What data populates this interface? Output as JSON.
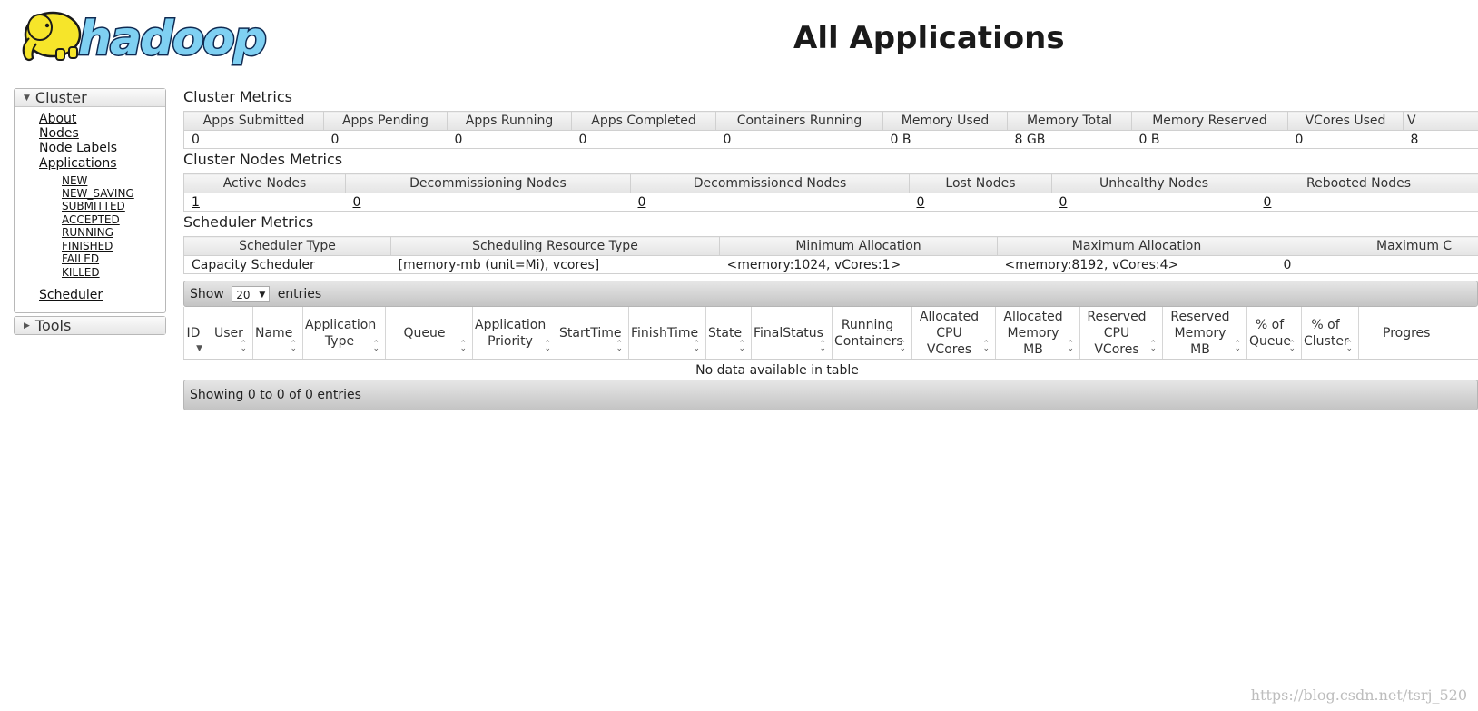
{
  "logo": {
    "wordmark": "hadoop"
  },
  "page_title": "All Applications",
  "sidebar": {
    "cluster": {
      "label": "Cluster",
      "links": [
        "About",
        "Nodes",
        "Node Labels",
        "Applications"
      ],
      "app_states": [
        "NEW",
        "NEW_SAVING",
        "SUBMITTED",
        "ACCEPTED",
        "RUNNING",
        "FINISHED",
        "FAILED",
        "KILLED"
      ],
      "scheduler": "Scheduler"
    },
    "tools": {
      "label": "Tools"
    }
  },
  "cluster_metrics": {
    "title": "Cluster Metrics",
    "headers": [
      "Apps Submitted",
      "Apps Pending",
      "Apps Running",
      "Apps Completed",
      "Containers Running",
      "Memory Used",
      "Memory Total",
      "Memory Reserved",
      "VCores Used",
      "V"
    ],
    "values": [
      "0",
      "0",
      "0",
      "0",
      "0",
      "0 B",
      "8 GB",
      "0 B",
      "0",
      "8"
    ]
  },
  "node_metrics": {
    "title": "Cluster Nodes Metrics",
    "headers": [
      "Active Nodes",
      "Decommissioning Nodes",
      "Decommissioned Nodes",
      "Lost Nodes",
      "Unhealthy Nodes",
      "Rebooted Nodes"
    ],
    "values": [
      "1",
      "0",
      "0",
      "0",
      "0",
      "0"
    ]
  },
  "scheduler_metrics": {
    "title": "Scheduler Metrics",
    "headers": [
      "Scheduler Type",
      "Scheduling Resource Type",
      "Minimum Allocation",
      "Maximum Allocation",
      "Maximum C"
    ],
    "values": [
      "Capacity Scheduler",
      "[memory-mb (unit=Mi), vcores]",
      "<memory:1024, vCores:1>",
      "<memory:8192, vCores:4>",
      "0"
    ]
  },
  "apps": {
    "show_label": "Show",
    "page_size": "20",
    "entries_label": "entries",
    "columns": [
      [
        "ID"
      ],
      [
        "User"
      ],
      [
        "Name"
      ],
      [
        "Application",
        "Type"
      ],
      [
        "Queue"
      ],
      [
        "Application",
        "Priority"
      ],
      [
        "StartTime"
      ],
      [
        "FinishTime"
      ],
      [
        "State"
      ],
      [
        "FinalStatus"
      ],
      [
        "Running",
        "Containers"
      ],
      [
        "Allocated",
        "CPU",
        "VCores"
      ],
      [
        "Allocated",
        "Memory",
        "MB"
      ],
      [
        "Reserved",
        "CPU",
        "VCores"
      ],
      [
        "Reserved",
        "Memory",
        "MB"
      ],
      [
        "% of",
        "Queue"
      ],
      [
        "% of",
        "Cluster"
      ],
      [
        "Progres"
      ]
    ],
    "empty_text": "No data available in table",
    "footer_text": "Showing 0 to 0 of 0 entries"
  },
  "watermark": "https://blog.csdn.net/tsrj_520"
}
